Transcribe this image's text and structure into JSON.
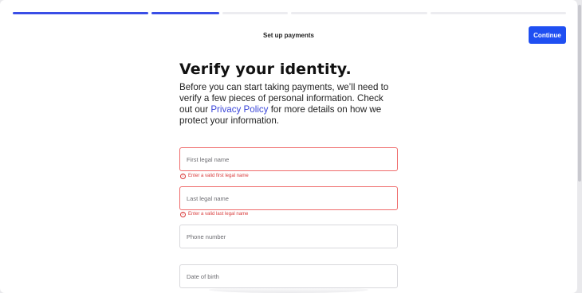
{
  "header": {
    "title": "Set up payments",
    "continue_label": "Continue"
  },
  "progress": {
    "steps": [
      {
        "state": "complete"
      },
      {
        "state": "current"
      },
      {
        "state": "upcoming"
      },
      {
        "state": "upcoming"
      },
      {
        "state": "upcoming"
      }
    ],
    "active_color": "#3a4ee6",
    "inactive_color": "#ececf0"
  },
  "main": {
    "title": "Verify your identity.",
    "intro_before_link": "Before you can start taking payments, we’ll need to verify a few pieces of personal information. Check out our ",
    "intro_link": "Privacy Policy",
    "intro_after_link": " for more details on how we protect your information."
  },
  "form": {
    "first_name": {
      "placeholder": "First legal name",
      "value": "",
      "error": "Enter a valid first legal name"
    },
    "last_name": {
      "placeholder": "Last legal name",
      "value": "",
      "error": "Enter a valid last legal name"
    },
    "phone": {
      "placeholder": "Phone number",
      "value": ""
    },
    "dob": {
      "placeholder": "Date of birth",
      "value": ""
    }
  },
  "colors": {
    "accent": "#1f4ff2",
    "error": "#d93b3b",
    "link": "#3b46d8"
  }
}
